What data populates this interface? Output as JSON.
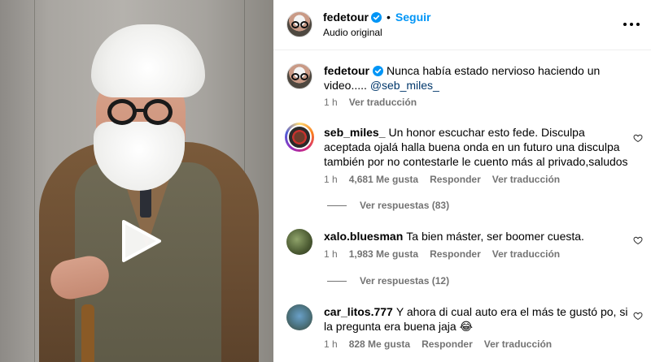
{
  "post": {
    "username": "fedetour",
    "follow_label": "Seguir",
    "separator": "•",
    "audio": "Audio original"
  },
  "caption": {
    "username": "fedetour",
    "text_line1": "Nunca había estado nervioso haciendo un",
    "text_line2_prefix": "video..... ",
    "mention": "@seb_miles_",
    "time": "1 h",
    "translate": "Ver traducción"
  },
  "comments": [
    {
      "username": "seb_miles_",
      "line1": "Un honor escuchar esto fede. Disculpa",
      "line2": "aceptada ojalá halla buena onda en un futuro una disculpa",
      "line3": "también por no contestarle le cuento más al privado,saludos",
      "time": "1 h",
      "likes": "4,681 Me gusta",
      "reply": "Responder",
      "translate": "Ver traducción",
      "view_replies": "Ver respuestas (83)"
    },
    {
      "username": "xalo.bluesman",
      "line1": "Ta bien máster, ser boomer cuesta.",
      "time": "1 h",
      "likes": "1,983 Me gusta",
      "reply": "Responder",
      "translate": "Ver traducción",
      "view_replies": "Ver respuestas (12)"
    },
    {
      "username": "car_litos.777",
      "line1": "Y ahora di cual auto era el más te gustó po, si",
      "line2": "la pregunta era buena jaja 😂",
      "time": "1 h",
      "likes": "828 Me gusta",
      "reply": "Responder",
      "translate": "Ver traducción"
    }
  ],
  "icons": {
    "verified": "verified-badge-icon",
    "more": "more-options-icon",
    "heart": "heart-icon",
    "play": "play-icon"
  },
  "colors": {
    "accent": "#0095f6",
    "verified": "#0095f6",
    "mention": "#00376b",
    "secondary_text": "#737373"
  }
}
